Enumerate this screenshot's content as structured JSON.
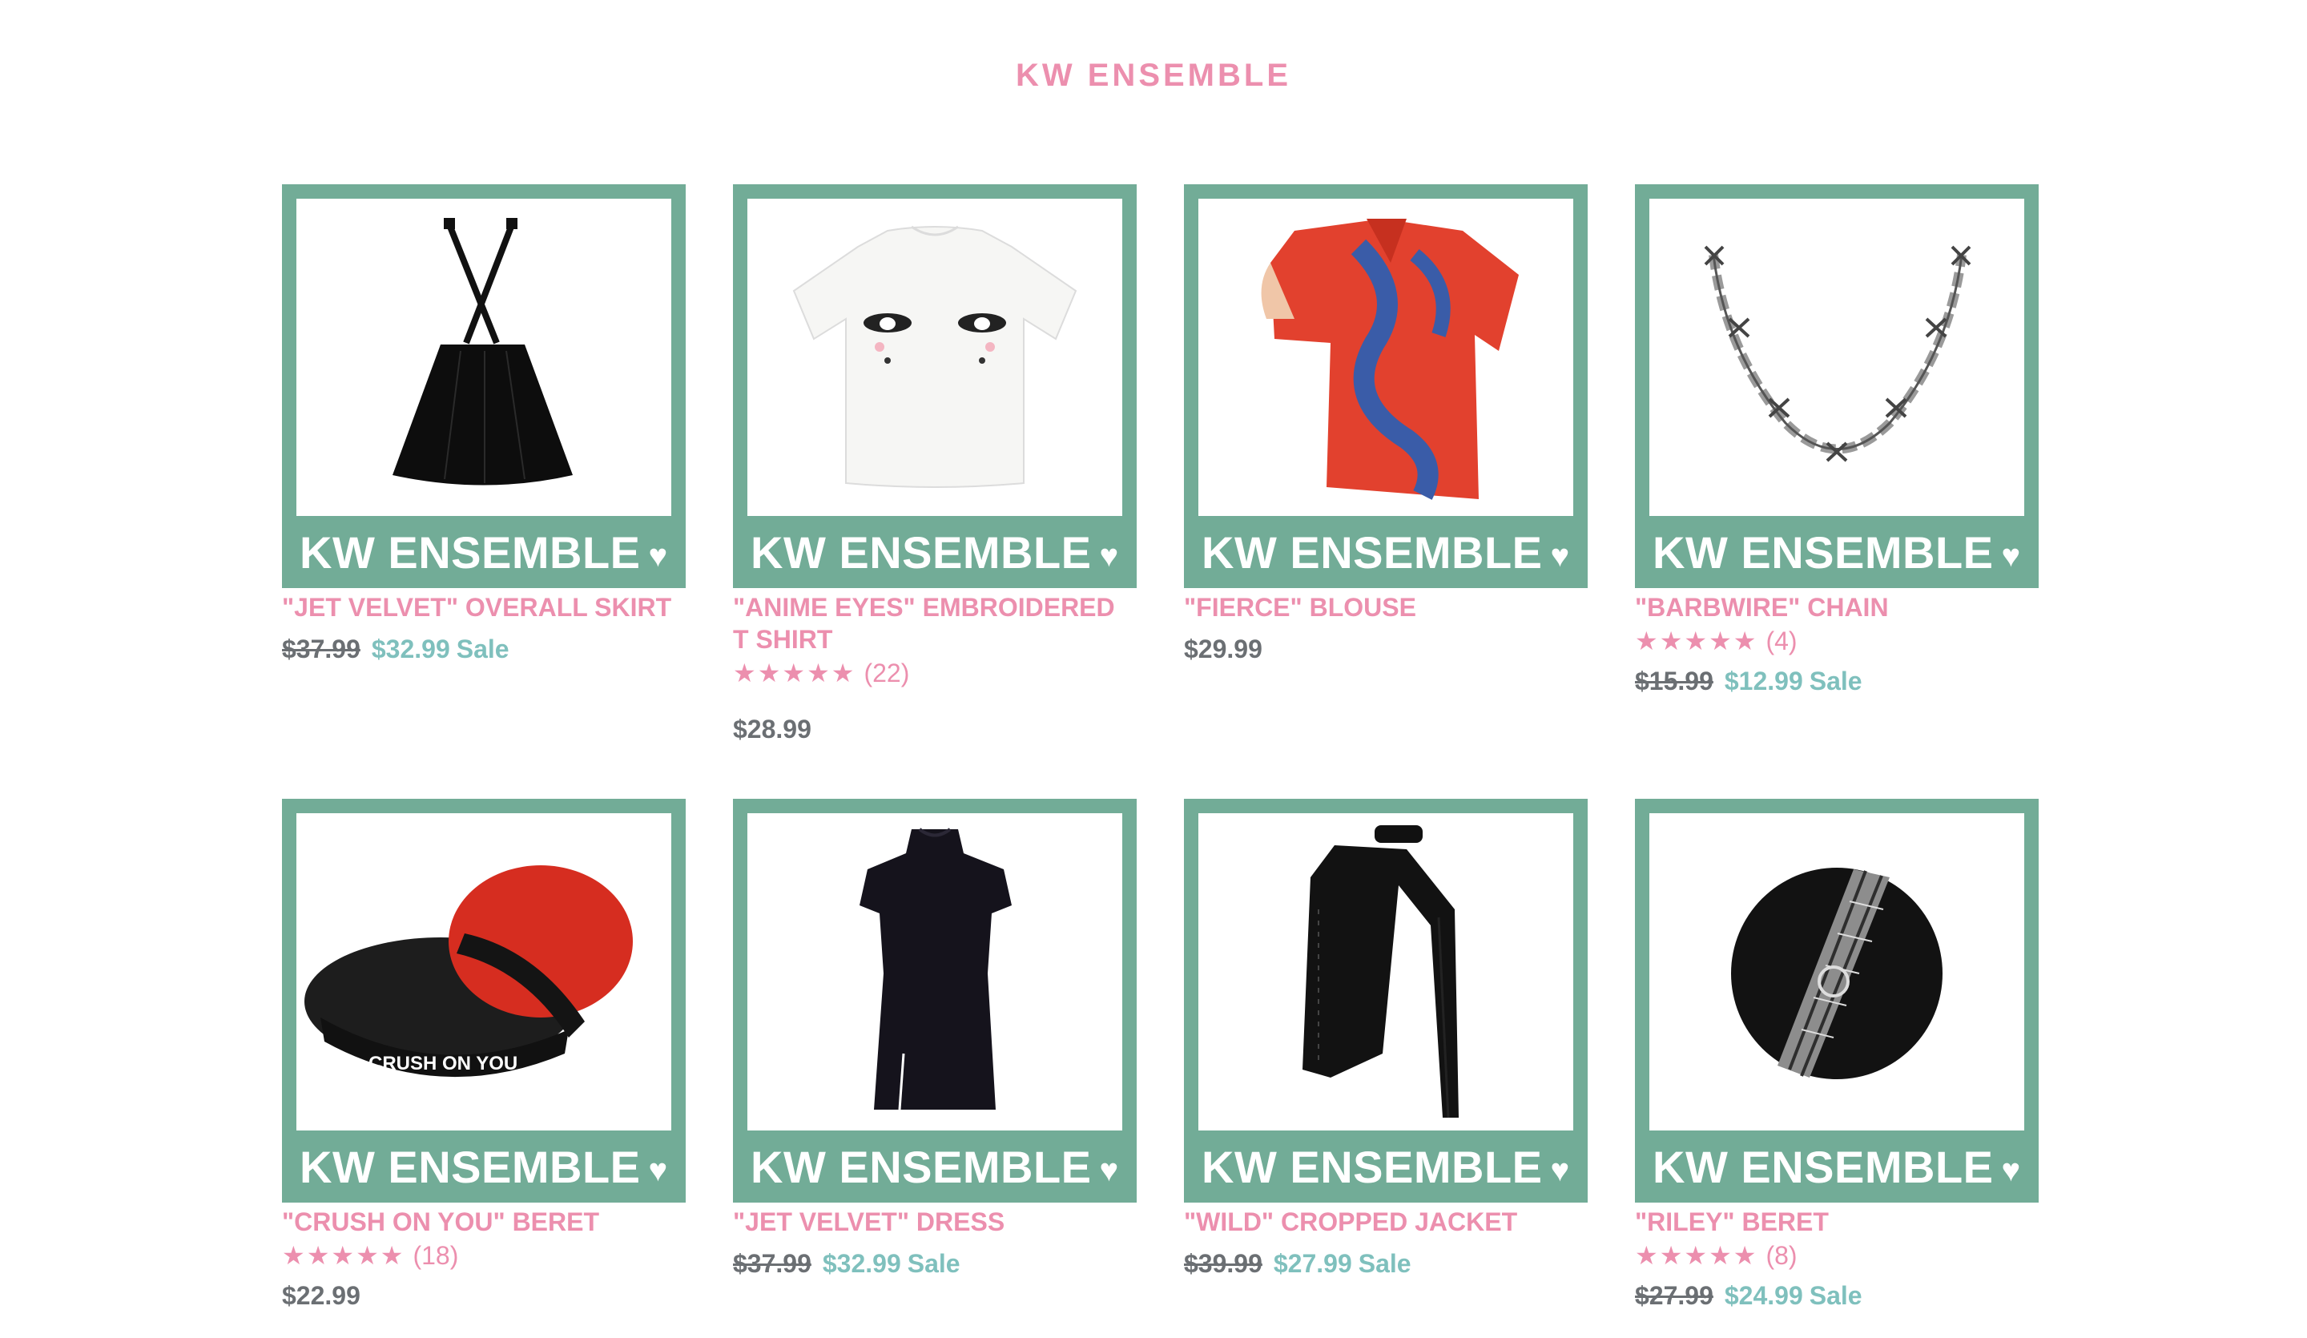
{
  "page": {
    "title": "KW ENSEMBLE"
  },
  "banner": {
    "text": "KW ENSEMBLE",
    "heart": "♥"
  },
  "colors": {
    "frame": "#72ac97",
    "accent_pink": "#ec8fae",
    "sale_teal": "#7fc0bd",
    "price_gray": "#6b6f73"
  },
  "products": [
    {
      "name": "\"JET VELVET\" OVERALL SKIRT",
      "image_icon": "overall-skirt-image",
      "old_price": "$37.99",
      "price": "$32.99",
      "sale_label": "Sale"
    },
    {
      "name": "\"ANIME EYES\" EMBROIDERED T SHIRT",
      "image_icon": "anime-eyes-tshirt-image",
      "stars": "★★★★★",
      "rating_count": "(22)",
      "price": "$28.99"
    },
    {
      "name": "\"FIERCE\" BLOUSE",
      "image_icon": "dragon-blouse-image",
      "price": "$29.99"
    },
    {
      "name": "\"BARBWIRE\" CHAIN",
      "image_icon": "barbwire-chain-image",
      "stars": "★★★★★",
      "rating_count": "(4)",
      "old_price": "$15.99",
      "price": "$12.99",
      "sale_label": "Sale"
    },
    {
      "name": "\"CRUSH ON YOU\" BERET",
      "image_icon": "crush-on-you-berets-image",
      "image_text": "CRUSH ON YOU",
      "stars": "★★★★★",
      "rating_count": "(18)",
      "price": "$22.99"
    },
    {
      "name": "\"JET VELVET\" DRESS",
      "image_icon": "velvet-dress-image",
      "old_price": "$37.99",
      "price": "$32.99",
      "sale_label": "Sale"
    },
    {
      "name": "\"WILD\" CROPPED JACKET",
      "image_icon": "cropped-jacket-image",
      "old_price": "$39.99",
      "price": "$27.99",
      "sale_label": "Sale"
    },
    {
      "name": "\"RILEY\" BERET",
      "image_icon": "plaid-beret-image",
      "stars": "★★★★★",
      "rating_count": "(8)",
      "old_price": "$27.99",
      "price": "$24.99",
      "sale_label": "Sale"
    }
  ]
}
